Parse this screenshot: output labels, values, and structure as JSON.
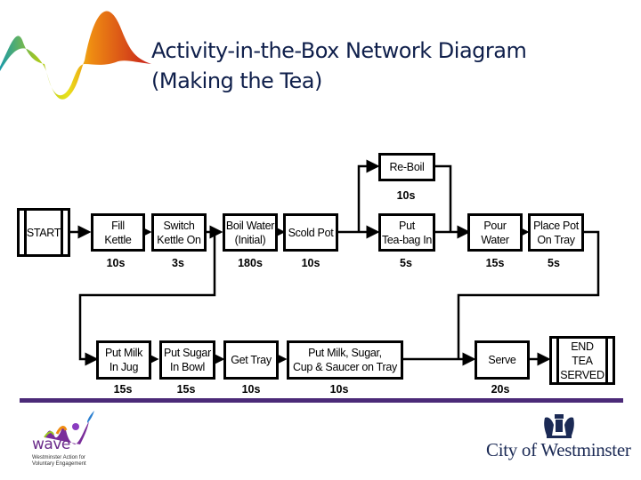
{
  "title": {
    "line1": "Activity-in-the-Box Network Diagram",
    "line2": "(Making the Tea)"
  },
  "diagram": {
    "start": "START",
    "end": "END\nTEA\nSERVED",
    "activities": [
      {
        "id": "fill-kettle",
        "label": "Fill\nKettle",
        "duration": "10s"
      },
      {
        "id": "switch-kettle-on",
        "label": "Switch\nKettle On",
        "duration": "3s"
      },
      {
        "id": "boil-water",
        "label": "Boil Water\n(Initial)",
        "duration": "180s"
      },
      {
        "id": "scold-pot",
        "label": "Scold Pot",
        "duration": "10s"
      },
      {
        "id": "re-boil",
        "label": "Re-Boil",
        "duration": "10s"
      },
      {
        "id": "put-tea-bag-in",
        "label": "Put\nTea-bag In",
        "duration": "5s"
      },
      {
        "id": "pour-water",
        "label": "Pour\nWater",
        "duration": "15s"
      },
      {
        "id": "place-pot-on-tray",
        "label": "Place Pot\nOn Tray",
        "duration": "5s"
      },
      {
        "id": "put-milk-in-jug",
        "label": "Put Milk\nIn Jug",
        "duration": "15s"
      },
      {
        "id": "put-sugar-in-bowl",
        "label": "Put Sugar\nIn Bowl",
        "duration": "15s"
      },
      {
        "id": "get-tray",
        "label": "Get Tray",
        "duration": "10s"
      },
      {
        "id": "put-milk-sugar-cup-saucer",
        "label": "Put Milk, Sugar,\nCup & Saucer on Tray",
        "duration": "10s"
      },
      {
        "id": "serve",
        "label": "Serve",
        "duration": "20s"
      }
    ]
  },
  "footer": {
    "wave_word": "wave",
    "wave_tagline": "Westminster Action for\nVoluntary Engagement",
    "council": "City of Westminster",
    "accent_color": "#4b2a78"
  }
}
